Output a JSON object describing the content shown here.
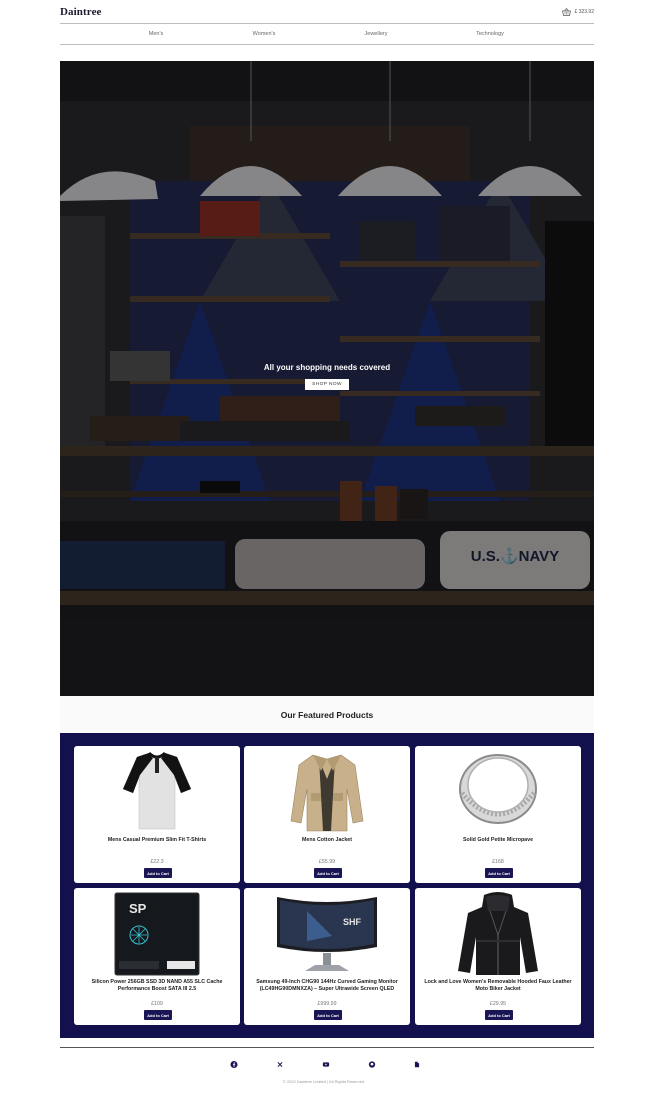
{
  "header": {
    "brand": "Daintree",
    "cart_total": "£ 323.92"
  },
  "nav": {
    "items": [
      {
        "label": "Men's"
      },
      {
        "label": "Women's"
      },
      {
        "label": "Jewellery"
      },
      {
        "label": "Technology"
      }
    ]
  },
  "hero": {
    "title": "All your shopping needs covered",
    "button_label": "SHOP NOW"
  },
  "featured": {
    "title": "Our Featured Products",
    "add_label": "Add to Cart",
    "products": [
      {
        "name": "Mens Casual Premium Slim Fit T-Shirts",
        "price": "£22.3",
        "image": "raglan-tshirt"
      },
      {
        "name": "Mens Cotton Jacket",
        "price": "£55.99",
        "image": "beige-jacket"
      },
      {
        "name": "Solid Gold Petite Micropave",
        "price": "£168",
        "image": "silver-ring"
      },
      {
        "name": "Silicon Power 256GB SSD 3D NAND A55 SLC Cache Performance Boost SATA III 2.5",
        "price": "£109",
        "image": "ssd-drive"
      },
      {
        "name": "Samsung 49-Inch CHG90 144Hz Curved Gaming Monitor (LC49HG90DMNXZA) – Super Ultrawide Screen QLED",
        "price": "£999.99",
        "image": "curved-monitor"
      },
      {
        "name": "Lock and Love Women's Removable Hooded Faux Leather Moto Biker Jacket",
        "price": "£29.95",
        "image": "leather-jacket"
      }
    ]
  },
  "footer": {
    "socials": [
      {
        "icon": "facebook-icon"
      },
      {
        "icon": "x-icon"
      },
      {
        "icon": "youtube-icon"
      },
      {
        "icon": "github-icon"
      },
      {
        "icon": "document-icon"
      }
    ],
    "copyright": "© 2022 Daintree Limited | All Rights Reserved"
  },
  "colors": {
    "accent": "#1a1554",
    "products_bg": "#13104e"
  }
}
